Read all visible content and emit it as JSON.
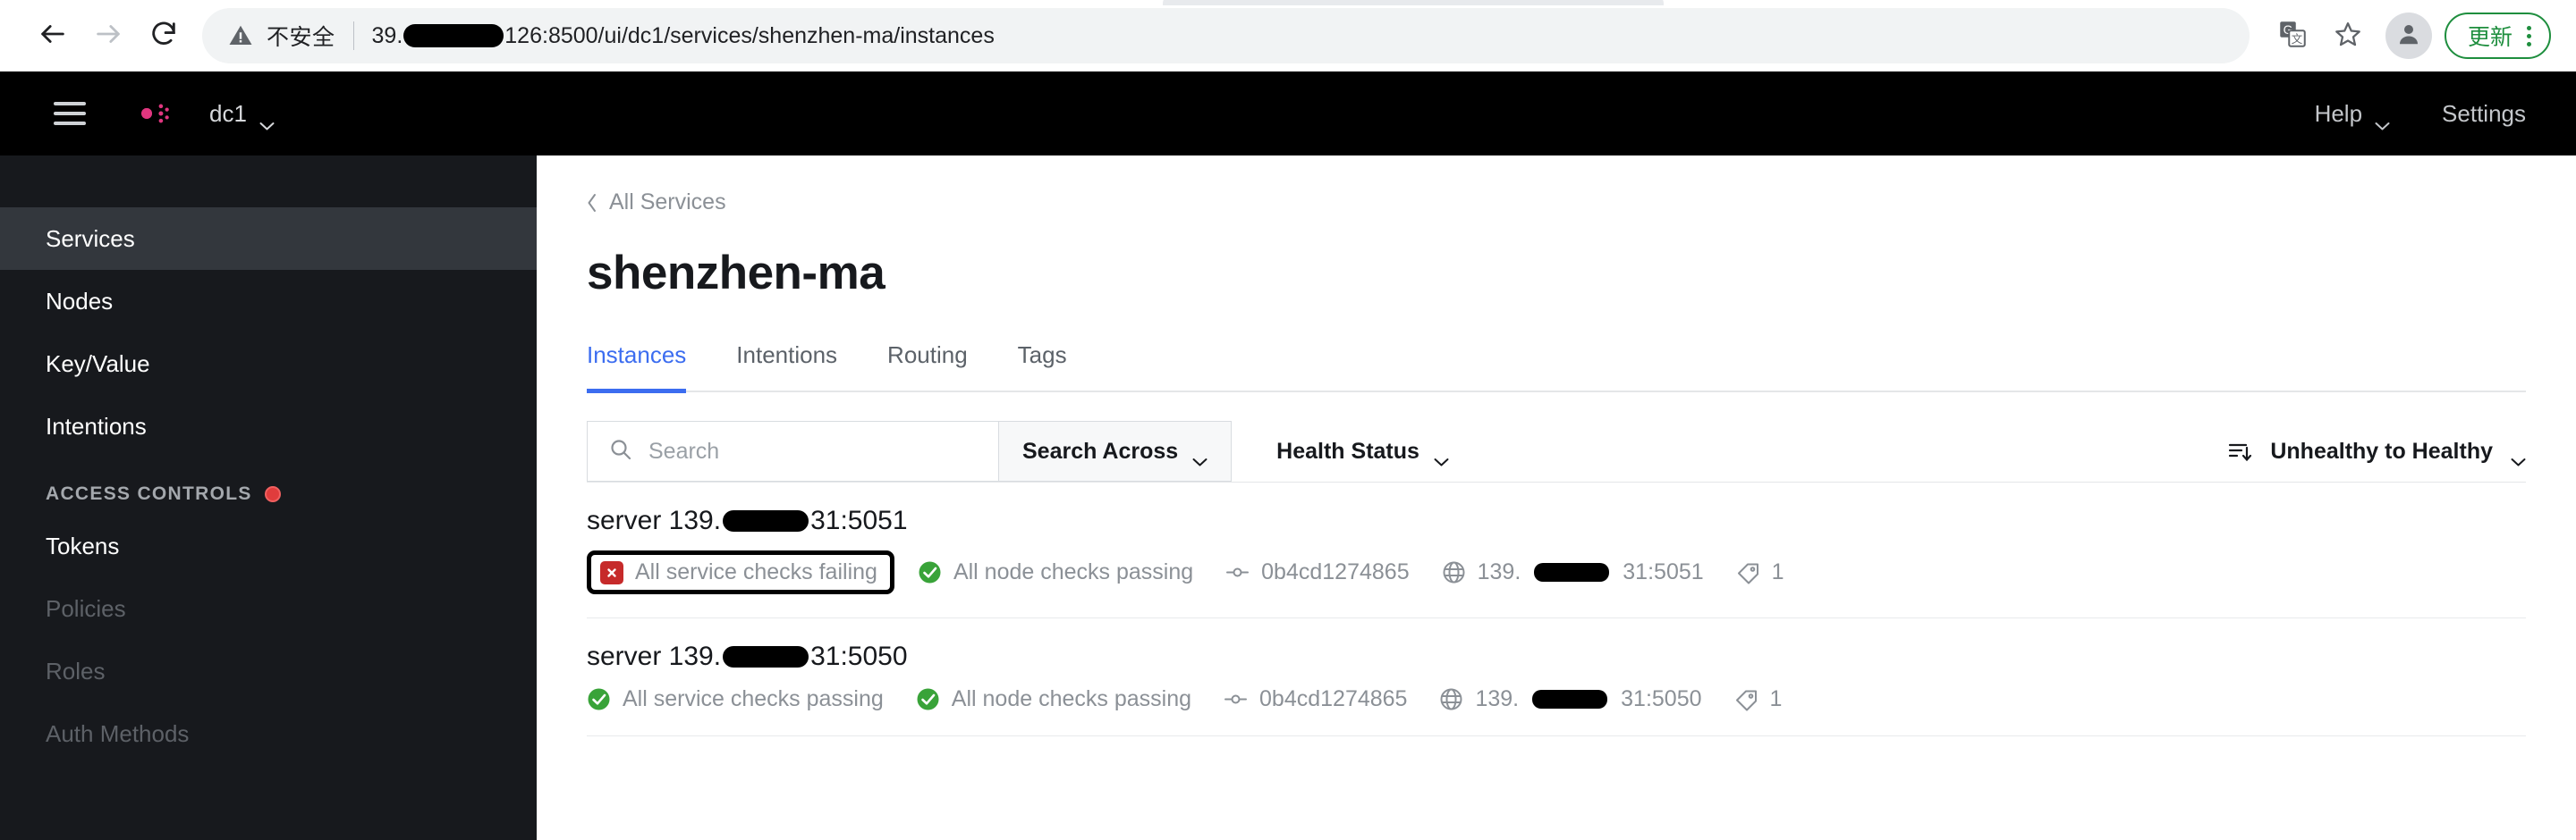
{
  "browser": {
    "back_icon": "back-arrow-icon",
    "forward_icon": "forward-arrow-icon",
    "reload_icon": "reload-icon",
    "security_label": "不安全",
    "url_prefix": "39.",
    "url_suffix": "126:8500/ui/dc1/services/shenzhen-ma/instances",
    "translate_icon": "translate-icon",
    "bookmark_icon": "star-icon",
    "profile_icon": "profile-avatar-icon",
    "update_label": "更新",
    "menu_icon": "kebab-menu-icon",
    "accent_green": "#1e8e3e"
  },
  "topnav": {
    "menu_icon": "hamburger-icon",
    "logo_icon": "consul-logo-icon",
    "logo_color": "#e0367f",
    "datacenter": "dc1",
    "help_label": "Help",
    "settings_label": "Settings"
  },
  "sidebar": {
    "items": [
      {
        "label": "Services",
        "active": true
      },
      {
        "label": "Nodes",
        "active": false
      },
      {
        "label": "Key/Value",
        "active": false
      },
      {
        "label": "Intentions",
        "active": false
      }
    ],
    "group_label": "ACCESS CONTROLS",
    "group_badge_color": "#e03c3c",
    "group_items": [
      {
        "label": "Tokens",
        "dim": false
      },
      {
        "label": "Policies",
        "dim": true
      },
      {
        "label": "Roles",
        "dim": true
      },
      {
        "label": "Auth Methods",
        "dim": true
      }
    ]
  },
  "main": {
    "breadcrumb": "All Services",
    "breadcrumb_icon": "chevron-left-icon",
    "title": "shenzhen-ma",
    "tabs": [
      {
        "label": "Instances",
        "active": true
      },
      {
        "label": "Intentions",
        "active": false
      },
      {
        "label": "Routing",
        "active": false
      },
      {
        "label": "Tags",
        "active": false
      }
    ],
    "accent_blue": "#3c6df0"
  },
  "filters": {
    "search_placeholder": "Search",
    "search_value": "",
    "search_icon": "search-icon",
    "search_across_label": "Search Across",
    "health_status_label": "Health Status",
    "sort_icon": "sort-descending-icon",
    "sort_label": "Unhealthy to Healthy",
    "chevron_icon": "chevron-down-icon"
  },
  "instances": [
    {
      "name_prefix": "server 139.",
      "name_suffix": "31:5051",
      "service_check_status": "failing",
      "service_check_label": "All service checks failing",
      "service_check_icon": "x-circle-icon",
      "node_check_status": "passing",
      "node_check_label": "All node checks passing",
      "node_check_icon": "check-circle-icon",
      "node_id": "0b4cd1274865",
      "node_id_icon": "node-icon",
      "address_icon": "globe-icon",
      "address_prefix": "139.",
      "address_suffix": "31:5051",
      "tag_icon": "tag-icon",
      "tag_count": "1",
      "annotated": true
    },
    {
      "name_prefix": "server 139.",
      "name_suffix": "31:5050",
      "service_check_status": "passing",
      "service_check_label": "All service checks passing",
      "service_check_icon": "check-circle-icon",
      "node_check_status": "passing",
      "node_check_label": "All node checks passing",
      "node_check_icon": "check-circle-icon",
      "node_id": "0b4cd1274865",
      "node_id_icon": "node-icon",
      "address_icon": "globe-icon",
      "address_prefix": "139.",
      "address_suffix": "31:5050",
      "tag_icon": "tag-icon",
      "tag_count": "1",
      "annotated": false
    }
  ],
  "colors": {
    "fail_red": "#c62a2a",
    "pass_green": "#39a339",
    "text_muted": "#8b9096"
  }
}
